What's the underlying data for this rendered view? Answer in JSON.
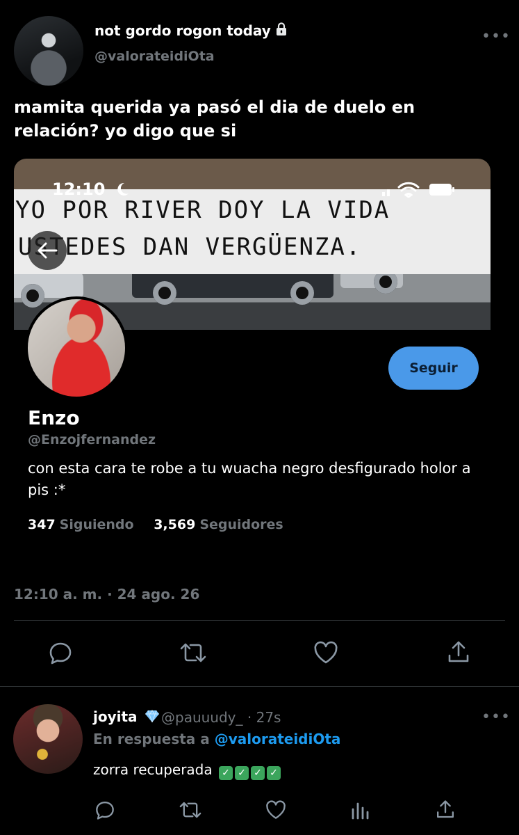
{
  "tweet": {
    "display_name": "not gordo rogon today",
    "handle": "@valorateidiOta",
    "text": "mamita querida ya pasó el dia de duelo en relación? yo digo que si",
    "timestamp": "12:10 a. m. · 24 ago. 26"
  },
  "embedded_screenshot": {
    "status_time": "12:10",
    "banner_line1": "YO POR RIVER DOY LA VIDA",
    "banner_line2": "USTEDES DAN VERGÜENZA.",
    "profile": {
      "name": "Enzo",
      "handle": "@Enzojfernandez",
      "bio": "con esta cara te robe a tu wuacha negro desfigurado holor a pis :*",
      "following_count": "347",
      "following_label": "Siguiendo",
      "followers_count": "3,569",
      "followers_label": "Seguidores",
      "follow_button": "Seguir"
    }
  },
  "reply": {
    "display_name": "joyita",
    "handle": "@pauuudy_",
    "time": "· 27s",
    "replying_to_label": "En respuesta a",
    "replying_to_handle": "@valorateidiOta",
    "text": "zorra recuperada",
    "emoji": [
      "✓",
      "✓",
      "✓",
      "✓"
    ]
  },
  "colors": {
    "background": "#000000",
    "muted": "#71767b",
    "accent": "#1d9bf0",
    "follow_button": "#4a99e9"
  },
  "icons": [
    "lock-icon",
    "more-icon",
    "reply-icon",
    "retweet-icon",
    "like-icon",
    "share-icon",
    "verified-icon",
    "views-icon",
    "back-arrow-icon",
    "moon-icon"
  ]
}
